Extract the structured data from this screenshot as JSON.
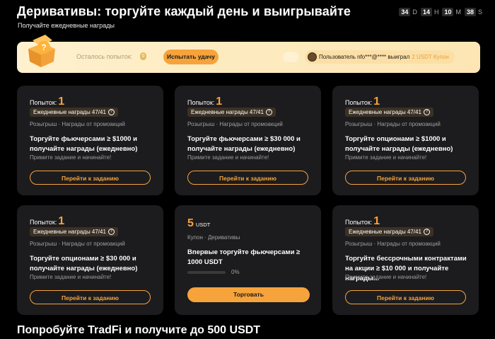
{
  "header": {
    "title": "Деривативы: торгуйте каждый день и выигрывайте",
    "subtitle": "Получайте ежедневные награды"
  },
  "countdown": [
    {
      "value": "34",
      "unit": "D"
    },
    {
      "value": "14",
      "unit": "H"
    },
    {
      "value": "10",
      "unit": "M"
    },
    {
      "value": "38",
      "unit": "S"
    }
  ],
  "banner": {
    "attempts_label": "Осталось попыток:",
    "attempts_value": "0",
    "try_button": "Испытать удачу",
    "notice_prefix": "Пользователь nfo***@**** выиграл ",
    "notice_reward": "2 USDT Купон"
  },
  "tasks": [
    {
      "attempts_label": "Попыток:",
      "attempts": "1",
      "badge": "Ежедневные награды 47/41",
      "tags": "Розыгрыш · Награды от промоакций",
      "title": "Торгуйте фьючерсами ≥ $1000 и получайте награды (ежедневно)",
      "hint": "Примите задание и начинайте!",
      "button": "Перейти к заданию"
    },
    {
      "attempts_label": "Попыток:",
      "attempts": "1",
      "badge": "Ежедневные награды 47/41",
      "tags": "Розыгрыш · Награды от промоакций",
      "title": "Торгуйте фьючерсами ≥ $30 000 и получайте награды (ежедневно)",
      "hint": "Примите задание и начинайте!",
      "button": "Перейти к заданию"
    },
    {
      "attempts_label": "Попыток:",
      "attempts": "1",
      "badge": "Ежедневные награды 47/41",
      "tags": "Розыгрыш · Награды от промоакций",
      "title": "Торгуйте опционами ≥ $1000 и получайте награды (ежедневно)",
      "hint": "Примите задание и начинайте!",
      "button": "Перейти к заданию"
    },
    {
      "attempts_label": "Попыток:",
      "attempts": "1",
      "badge": "Ежедневные награды 47/41",
      "tags": "Розыгрыш · Награды от промоакций",
      "title": "Торгуйте опционами ≥ $30 000 и получайте награды (ежедневно)",
      "hint": "Примите задание и начинайте!",
      "button": "Перейти к заданию"
    },
    {
      "attempts_label": "Попыток:",
      "attempts": "1",
      "badge": "Ежедневные награды 47/41",
      "tags": "Розыгрыш · Награды от промоакций",
      "title": "Торгуйте бессрочными контрактами на акции ≥ $10 000 и получайте награды...",
      "hint": "Примите задание и начинайте!",
      "button": "Перейти к заданию"
    }
  ],
  "coupon_task": {
    "amount": "5",
    "unit": "USDT",
    "tags": "Купон · Деривативы",
    "title": "Впервые торгуйте фьючерсами ≥ 1000 USDT",
    "progress": 0,
    "progress_text": "0%",
    "button": "Торговать"
  },
  "footer": {
    "title": "Попробуйте TradFi и получите до 500 USDT"
  },
  "colors": {
    "accent": "#f7a33b",
    "card_bg": "#1c1c1e",
    "banner_bg": "#fdebc0"
  }
}
